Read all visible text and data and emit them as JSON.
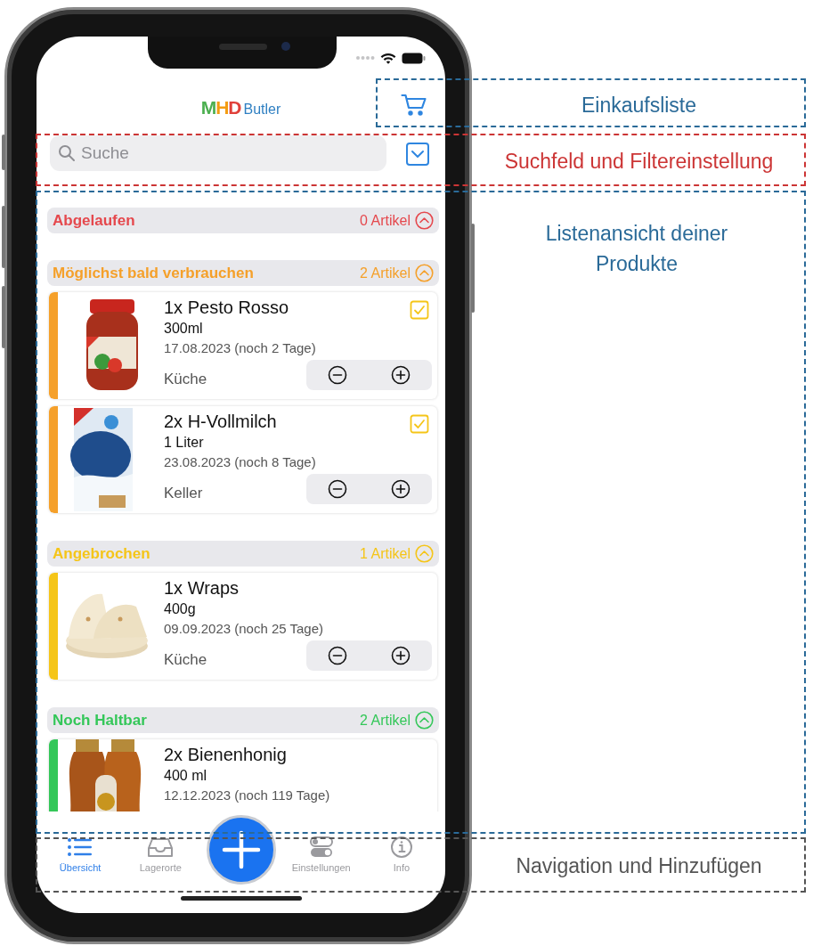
{
  "header": {
    "logo": {
      "letters": [
        {
          "text": "M",
          "color": "#4caf50"
        },
        {
          "text": "H",
          "color": "#f39c12"
        },
        {
          "text": "D",
          "color": "#e0403a"
        }
      ],
      "suffix": "Butler"
    }
  },
  "search": {
    "placeholder": "Suche"
  },
  "sections": [
    {
      "title": "Abgelaufen",
      "count": "0 Artikel",
      "color": "#e5484d",
      "expanded": true
    },
    {
      "title": "Möglichst bald verbrauchen",
      "count": "2 Artikel",
      "color": "#f5a02a",
      "expanded": true,
      "items": [
        {
          "name": "1x Pesto Rosso",
          "size": "300ml",
          "date": "17.08.2023 (noch 2 Tage)",
          "location": "Küche",
          "checked": true
        },
        {
          "name": "2x H-Vollmilch",
          "size": "1 Liter",
          "date": "23.08.2023 (noch 8 Tage)",
          "location": "Keller",
          "checked": true
        }
      ]
    },
    {
      "title": "Angebrochen",
      "count": "1 Artikel",
      "color": "#f5c518",
      "expanded": true,
      "items": [
        {
          "name": "1x Wraps",
          "size": "400g",
          "date": "09.09.2023 (noch 25 Tage)",
          "location": "Küche"
        }
      ]
    },
    {
      "title": "Noch Haltbar",
      "count": "2 Artikel",
      "color": "#34c759",
      "expanded": true,
      "items": [
        {
          "name": "2x Bienenhonig",
          "size": "400 ml",
          "date": "12.12.2023 (noch 119 Tage)"
        }
      ]
    }
  ],
  "tabs": [
    {
      "label": "Übersicht",
      "selected": true
    },
    {
      "label": "Lagerorte",
      "selected": false
    },
    {
      "label": "Einstellungen",
      "selected": false
    },
    {
      "label": "Info",
      "selected": false
    }
  ],
  "annotations": [
    {
      "label": "Einkaufsliste",
      "color": "#2a6a98"
    },
    {
      "label": "Suchfeld und Filtereinstellung",
      "color": "#cc3535"
    },
    {
      "label": "Listenansicht deiner Produkte",
      "color": "#2a6a98"
    },
    {
      "label": "Navigation und Hinzufügen",
      "color": "#555555"
    }
  ]
}
